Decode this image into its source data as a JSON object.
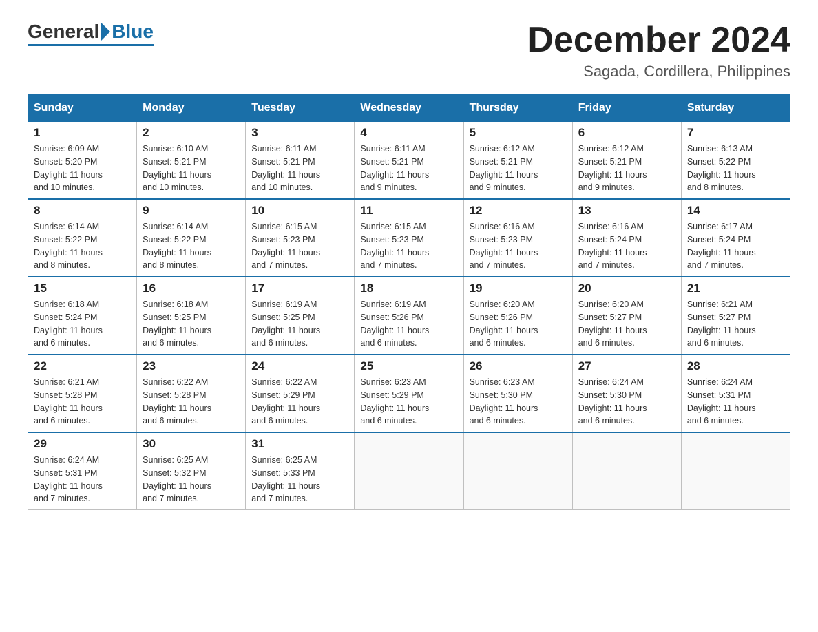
{
  "logo": {
    "general": "General",
    "blue": "Blue"
  },
  "header": {
    "month": "December 2024",
    "location": "Sagada, Cordillera, Philippines"
  },
  "weekdays": [
    "Sunday",
    "Monday",
    "Tuesday",
    "Wednesday",
    "Thursday",
    "Friday",
    "Saturday"
  ],
  "weeks": [
    [
      {
        "day": "1",
        "sunrise": "6:09 AM",
        "sunset": "5:20 PM",
        "daylight": "11 hours and 10 minutes."
      },
      {
        "day": "2",
        "sunrise": "6:10 AM",
        "sunset": "5:21 PM",
        "daylight": "11 hours and 10 minutes."
      },
      {
        "day": "3",
        "sunrise": "6:11 AM",
        "sunset": "5:21 PM",
        "daylight": "11 hours and 10 minutes."
      },
      {
        "day": "4",
        "sunrise": "6:11 AM",
        "sunset": "5:21 PM",
        "daylight": "11 hours and 9 minutes."
      },
      {
        "day": "5",
        "sunrise": "6:12 AM",
        "sunset": "5:21 PM",
        "daylight": "11 hours and 9 minutes."
      },
      {
        "day": "6",
        "sunrise": "6:12 AM",
        "sunset": "5:21 PM",
        "daylight": "11 hours and 9 minutes."
      },
      {
        "day": "7",
        "sunrise": "6:13 AM",
        "sunset": "5:22 PM",
        "daylight": "11 hours and 8 minutes."
      }
    ],
    [
      {
        "day": "8",
        "sunrise": "6:14 AM",
        "sunset": "5:22 PM",
        "daylight": "11 hours and 8 minutes."
      },
      {
        "day": "9",
        "sunrise": "6:14 AM",
        "sunset": "5:22 PM",
        "daylight": "11 hours and 8 minutes."
      },
      {
        "day": "10",
        "sunrise": "6:15 AM",
        "sunset": "5:23 PM",
        "daylight": "11 hours and 7 minutes."
      },
      {
        "day": "11",
        "sunrise": "6:15 AM",
        "sunset": "5:23 PM",
        "daylight": "11 hours and 7 minutes."
      },
      {
        "day": "12",
        "sunrise": "6:16 AM",
        "sunset": "5:23 PM",
        "daylight": "11 hours and 7 minutes."
      },
      {
        "day": "13",
        "sunrise": "6:16 AM",
        "sunset": "5:24 PM",
        "daylight": "11 hours and 7 minutes."
      },
      {
        "day": "14",
        "sunrise": "6:17 AM",
        "sunset": "5:24 PM",
        "daylight": "11 hours and 7 minutes."
      }
    ],
    [
      {
        "day": "15",
        "sunrise": "6:18 AM",
        "sunset": "5:24 PM",
        "daylight": "11 hours and 6 minutes."
      },
      {
        "day": "16",
        "sunrise": "6:18 AM",
        "sunset": "5:25 PM",
        "daylight": "11 hours and 6 minutes."
      },
      {
        "day": "17",
        "sunrise": "6:19 AM",
        "sunset": "5:25 PM",
        "daylight": "11 hours and 6 minutes."
      },
      {
        "day": "18",
        "sunrise": "6:19 AM",
        "sunset": "5:26 PM",
        "daylight": "11 hours and 6 minutes."
      },
      {
        "day": "19",
        "sunrise": "6:20 AM",
        "sunset": "5:26 PM",
        "daylight": "11 hours and 6 minutes."
      },
      {
        "day": "20",
        "sunrise": "6:20 AM",
        "sunset": "5:27 PM",
        "daylight": "11 hours and 6 minutes."
      },
      {
        "day": "21",
        "sunrise": "6:21 AM",
        "sunset": "5:27 PM",
        "daylight": "11 hours and 6 minutes."
      }
    ],
    [
      {
        "day": "22",
        "sunrise": "6:21 AM",
        "sunset": "5:28 PM",
        "daylight": "11 hours and 6 minutes."
      },
      {
        "day": "23",
        "sunrise": "6:22 AM",
        "sunset": "5:28 PM",
        "daylight": "11 hours and 6 minutes."
      },
      {
        "day": "24",
        "sunrise": "6:22 AM",
        "sunset": "5:29 PM",
        "daylight": "11 hours and 6 minutes."
      },
      {
        "day": "25",
        "sunrise": "6:23 AM",
        "sunset": "5:29 PM",
        "daylight": "11 hours and 6 minutes."
      },
      {
        "day": "26",
        "sunrise": "6:23 AM",
        "sunset": "5:30 PM",
        "daylight": "11 hours and 6 minutes."
      },
      {
        "day": "27",
        "sunrise": "6:24 AM",
        "sunset": "5:30 PM",
        "daylight": "11 hours and 6 minutes."
      },
      {
        "day": "28",
        "sunrise": "6:24 AM",
        "sunset": "5:31 PM",
        "daylight": "11 hours and 6 minutes."
      }
    ],
    [
      {
        "day": "29",
        "sunrise": "6:24 AM",
        "sunset": "5:31 PM",
        "daylight": "11 hours and 7 minutes."
      },
      {
        "day": "30",
        "sunrise": "6:25 AM",
        "sunset": "5:32 PM",
        "daylight": "11 hours and 7 minutes."
      },
      {
        "day": "31",
        "sunrise": "6:25 AM",
        "sunset": "5:33 PM",
        "daylight": "11 hours and 7 minutes."
      },
      null,
      null,
      null,
      null
    ]
  ],
  "labels": {
    "sunrise": "Sunrise:",
    "sunset": "Sunset:",
    "daylight": "Daylight:"
  }
}
